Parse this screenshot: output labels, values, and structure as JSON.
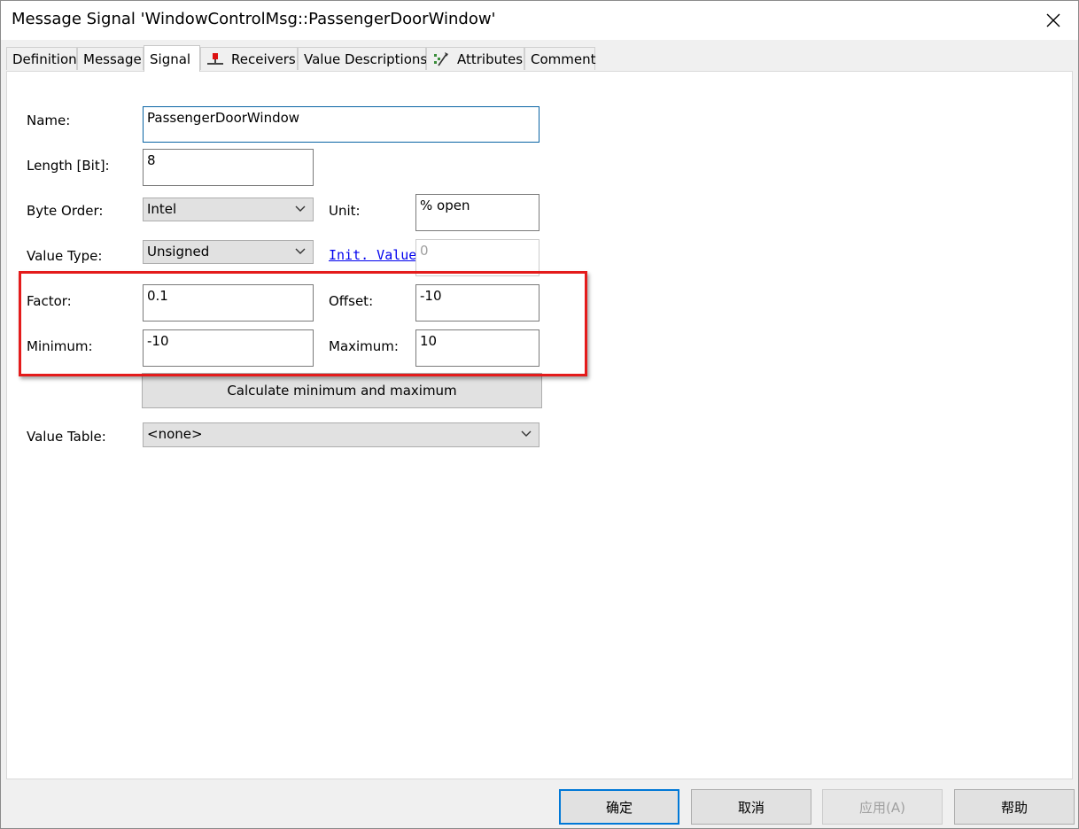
{
  "window": {
    "title": "Message Signal 'WindowControlMsg::PassengerDoorWindow'"
  },
  "tabs": [
    {
      "label": "Definition",
      "active": false
    },
    {
      "label": "Message",
      "active": false
    },
    {
      "label": "Signal",
      "active": true
    },
    {
      "label": "Receivers",
      "active": false,
      "icon": "receivers-icon"
    },
    {
      "label": "Value Descriptions",
      "active": false
    },
    {
      "label": "Attributes",
      "active": false,
      "icon": "attributes-icon"
    },
    {
      "label": "Comment",
      "active": false
    }
  ],
  "form": {
    "name_label": "Name:",
    "name_value": "PassengerDoorWindow",
    "length_label": "Length [Bit]:",
    "length_value": "8",
    "byte_order_label": "Byte Order:",
    "byte_order_value": "Intel",
    "unit_label": "Unit:",
    "unit_value": "% open",
    "value_type_label": "Value Type:",
    "value_type_value": "Unsigned",
    "init_value_link": "Init. Value",
    "init_value": "0",
    "factor_label": "Factor:",
    "factor_value": "0.1",
    "offset_label": "Offset:",
    "offset_value": "-10",
    "minimum_label": "Minimum:",
    "minimum_value": "-10",
    "maximum_label": "Maximum:",
    "maximum_value": "10",
    "calc_button": "Calculate minimum and maximum",
    "value_table_label": "Value Table:",
    "value_table_value": "<none>"
  },
  "footer": {
    "ok": "确定",
    "cancel": "取消",
    "apply": "应用(A)",
    "help": "帮助"
  },
  "colors": {
    "highlight_border": "#e41b1b",
    "focus_border": "#0a64a4",
    "link": "#0000ee",
    "default_button_border": "#0078d7"
  }
}
